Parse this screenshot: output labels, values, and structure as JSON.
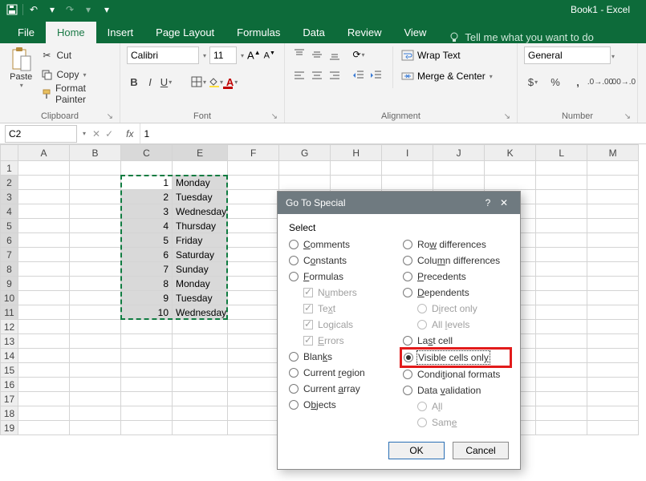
{
  "app": {
    "doc_title": "Book1 - Excel"
  },
  "tabs": {
    "file": "File",
    "home": "Home",
    "insert": "Insert",
    "page_layout": "Page Layout",
    "formulas": "Formulas",
    "data": "Data",
    "review": "Review",
    "view": "View",
    "tellme": "Tell me what you want to do"
  },
  "ribbon": {
    "clipboard": {
      "paste": "Paste",
      "cut": "Cut",
      "copy": "Copy",
      "painter": "Format Painter",
      "group": "Clipboard"
    },
    "font": {
      "name": "Calibri",
      "size": "11",
      "group": "Font"
    },
    "alignment": {
      "wrap": "Wrap Text",
      "merge": "Merge & Center",
      "group": "Alignment"
    },
    "number": {
      "format": "General",
      "group": "Number"
    }
  },
  "fbar": {
    "name": "C2",
    "formula": "1"
  },
  "columns": [
    "A",
    "B",
    "C",
    "E",
    "F",
    "G",
    "H",
    "I",
    "J",
    "K",
    "L",
    "M"
  ],
  "rows": [
    {
      "n": 1
    },
    {
      "n": 2,
      "c": "1",
      "e": "Monday"
    },
    {
      "n": 3,
      "c": "2",
      "e": "Tuesday"
    },
    {
      "n": 4,
      "c": "3",
      "e": "Wednesday"
    },
    {
      "n": 5,
      "c": "4",
      "e": "Thursday"
    },
    {
      "n": 6,
      "c": "5",
      "e": "Friday"
    },
    {
      "n": 7,
      "c": "6",
      "e": "Saturday"
    },
    {
      "n": 8,
      "c": "7",
      "e": "Sunday"
    },
    {
      "n": 9,
      "c": "8",
      "e": "Monday"
    },
    {
      "n": 10,
      "c": "9",
      "e": "Tuesday"
    },
    {
      "n": 11,
      "c": "10",
      "e": "Wednesday"
    },
    {
      "n": 12
    },
    {
      "n": 13
    },
    {
      "n": 14
    },
    {
      "n": 15
    },
    {
      "n": 16
    },
    {
      "n": 17
    },
    {
      "n": 18
    },
    {
      "n": 19
    }
  ],
  "dialog": {
    "title": "Go To Special",
    "select": "Select",
    "left": {
      "comments": "Comments",
      "constants": "Constants",
      "formulas": "Formulas",
      "numbers": "Numbers",
      "text": "Text",
      "logicals": "Logicals",
      "errors": "Errors",
      "blanks": "Blanks",
      "current_region": "Current region",
      "current_array": "Current array",
      "objects": "Objects"
    },
    "right": {
      "row_diff": "Row differences",
      "col_diff": "Column differences",
      "precedents": "Precedents",
      "dependents": "Dependents",
      "direct": "Direct only",
      "all_levels": "All levels",
      "last_cell": "Last cell",
      "visible": "Visible cells only",
      "cond": "Conditional formats",
      "data_val": "Data validation",
      "all": "All",
      "same": "Same"
    },
    "ok": "OK",
    "cancel": "Cancel"
  }
}
